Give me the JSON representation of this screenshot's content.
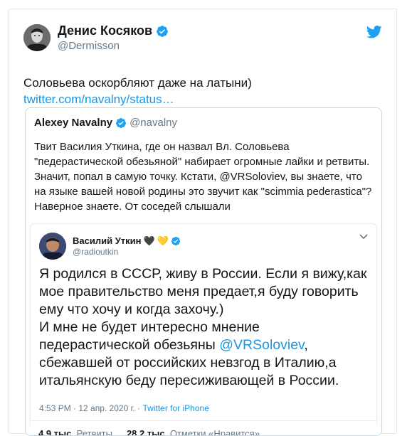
{
  "tweet": {
    "author_name": "Денис Косяков",
    "author_handle": "@Dermisson",
    "text": "Соловьева оскорбляют даже на латыни)",
    "link_text": "twitter.com/navalny/status…"
  },
  "quoted": {
    "author_name": "Alexey Navalny",
    "author_handle": "@navalny",
    "text_before_mention": "Твит Василия Уткина, где он назвал Вл. Соловьева \"педерастической обезьяной\" набирает огромные лайки и ретвиты. Значит, попал в самую точку. Кстати, ",
    "mention": "@VRSoloviev",
    "text_after_mention": ", вы знаете, что на языке вашей новой родины это звучит как \"scimmia pederastica\"? Наверное знаете. От соседей слышали"
  },
  "embedded": {
    "author_name": "Василий Уткин",
    "hearts": [
      "🖤",
      "💛"
    ],
    "author_handle": "@radioutkin",
    "text_part1": "Я родился в СССР, живу в России. Если я вижу,как мое правительство меня предает,я буду говорить ему что хочу и когда захочу.)\nИ мне не будет интересно мнение педерастической обезьяны ",
    "mention": "@VRSoloviev",
    "text_part2": ", сбежавшей от российских невзгод в Италию,а итальянскую беду пересиживающей в России.",
    "timestamp": "4:53 PM · 12 апр. 2020 г. · ",
    "source": "Twitter for iPhone"
  },
  "stats": {
    "retweets_count": "4,9 тыс.",
    "retweets_label": "Ретвиты",
    "likes_count": "28,2 тыс.",
    "likes_label": "Отметки «Нравится»"
  },
  "colors": {
    "link_blue": "#1b95e0",
    "verified_blue": "#1da1f2",
    "secondary_text": "#657786"
  },
  "icons": [
    "verified-badge-icon",
    "twitter-bird-icon",
    "chevron-down-icon",
    "black-heart-icon",
    "yellow-heart-icon"
  ]
}
